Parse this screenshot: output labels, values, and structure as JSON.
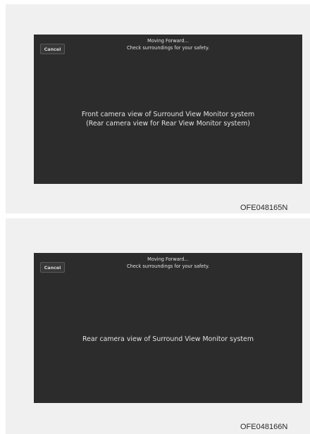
{
  "panels": [
    {
      "cancel_label": "Cancel",
      "header_line1": "Moving Forward...",
      "header_line2": "Check surroundings for your safety.",
      "center_line1": "Front camera view of Surround View Monitor system",
      "center_line2": "(Rear camera view for Rear View Monitor system)",
      "code": "OFE048165N"
    },
    {
      "cancel_label": "Cancel",
      "header_line1": "Moving Forward...",
      "header_line2": "Check surroundings for your safety.",
      "center_line1": "Rear camera view of Surround View Monitor system",
      "code": "OFE048166N"
    }
  ],
  "colors": {
    "screen_bg": "#2c2c2c",
    "panel_bg": "#f0f0f0",
    "text": "#e2e2e2"
  }
}
